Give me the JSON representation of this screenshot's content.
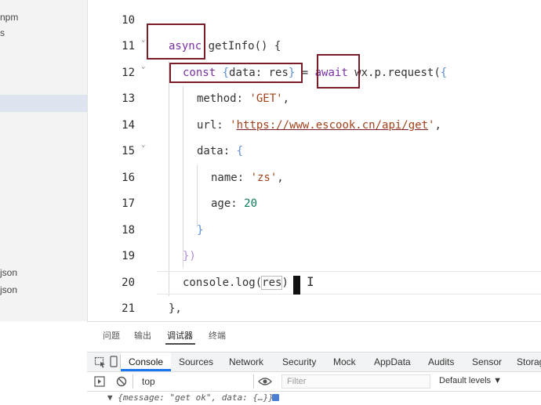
{
  "sidebar": {
    "items": [
      {
        "label": "npm"
      },
      {
        "label": "s"
      },
      {
        "label": "json"
      },
      {
        "label": "json"
      }
    ]
  },
  "editor": {
    "lines": [
      {
        "num": "10",
        "fold": false
      },
      {
        "num": "11",
        "fold": true
      },
      {
        "num": "12",
        "fold": true
      },
      {
        "num": "13",
        "fold": false
      },
      {
        "num": "14",
        "fold": false
      },
      {
        "num": "15",
        "fold": true
      },
      {
        "num": "16",
        "fold": false
      },
      {
        "num": "17",
        "fold": false
      },
      {
        "num": "18",
        "fold": false
      },
      {
        "num": "19",
        "fold": false
      },
      {
        "num": "20",
        "fold": false
      },
      {
        "num": "21",
        "fold": false
      }
    ],
    "code": {
      "l11_async": "async",
      "l11_rest": " getInfo() {",
      "l12_const": "const",
      "l12_open": " {",
      "l12_destr": "data: res",
      "l12_close": "}",
      "l12_eq": " = ",
      "l12_await": "await",
      "l12_call": " wx.p.request(",
      "l12_brace": "{",
      "l13_key": "method: ",
      "l13_val": "'GET'",
      "l13_comma": ",",
      "l14_key": "url: ",
      "l14_q1": "'",
      "l14_val": "https://www.escook.cn/api/get",
      "l14_q2": "'",
      "l14_comma": ",",
      "l15_key": "data: ",
      "l15_brace": "{",
      "l16_key": "name: ",
      "l16_val": "'zs'",
      "l16_comma": ",",
      "l17_key": "age: ",
      "l17_val": "20",
      "l18_brace": "}",
      "l19_close": "})",
      "l20_a": "console.log(",
      "l20_b": "res",
      "l20_c": ")",
      "l21": "},"
    }
  },
  "panel": {
    "tabs": [
      "问题",
      "输出",
      "调试器",
      "终端"
    ],
    "active_tab": "调试器",
    "devtools_tabs": [
      "Console",
      "Sources",
      "Network",
      "Security",
      "Mock",
      "AppData",
      "Audits",
      "Sensor",
      "Storag"
    ],
    "active_devtools_tab": "Console",
    "context": "top",
    "filter_placeholder": "Filter",
    "levels": "Default levels ▼",
    "log_preview": "▼ {message: \"get ok\", data: {…}} "
  },
  "colors": {
    "highlight_box": "#7b1c2b",
    "keyword": "#7a2fa6",
    "string": "#a3421a",
    "number": "#0b7a5c",
    "active_tab_underline": "#1a73e8"
  },
  "icons": [
    "fold-arrow-icon",
    "inspect-icon",
    "device-icon",
    "sidebar-toggle-icon",
    "clear-icon",
    "eye-icon",
    "info-badge-icon"
  ]
}
